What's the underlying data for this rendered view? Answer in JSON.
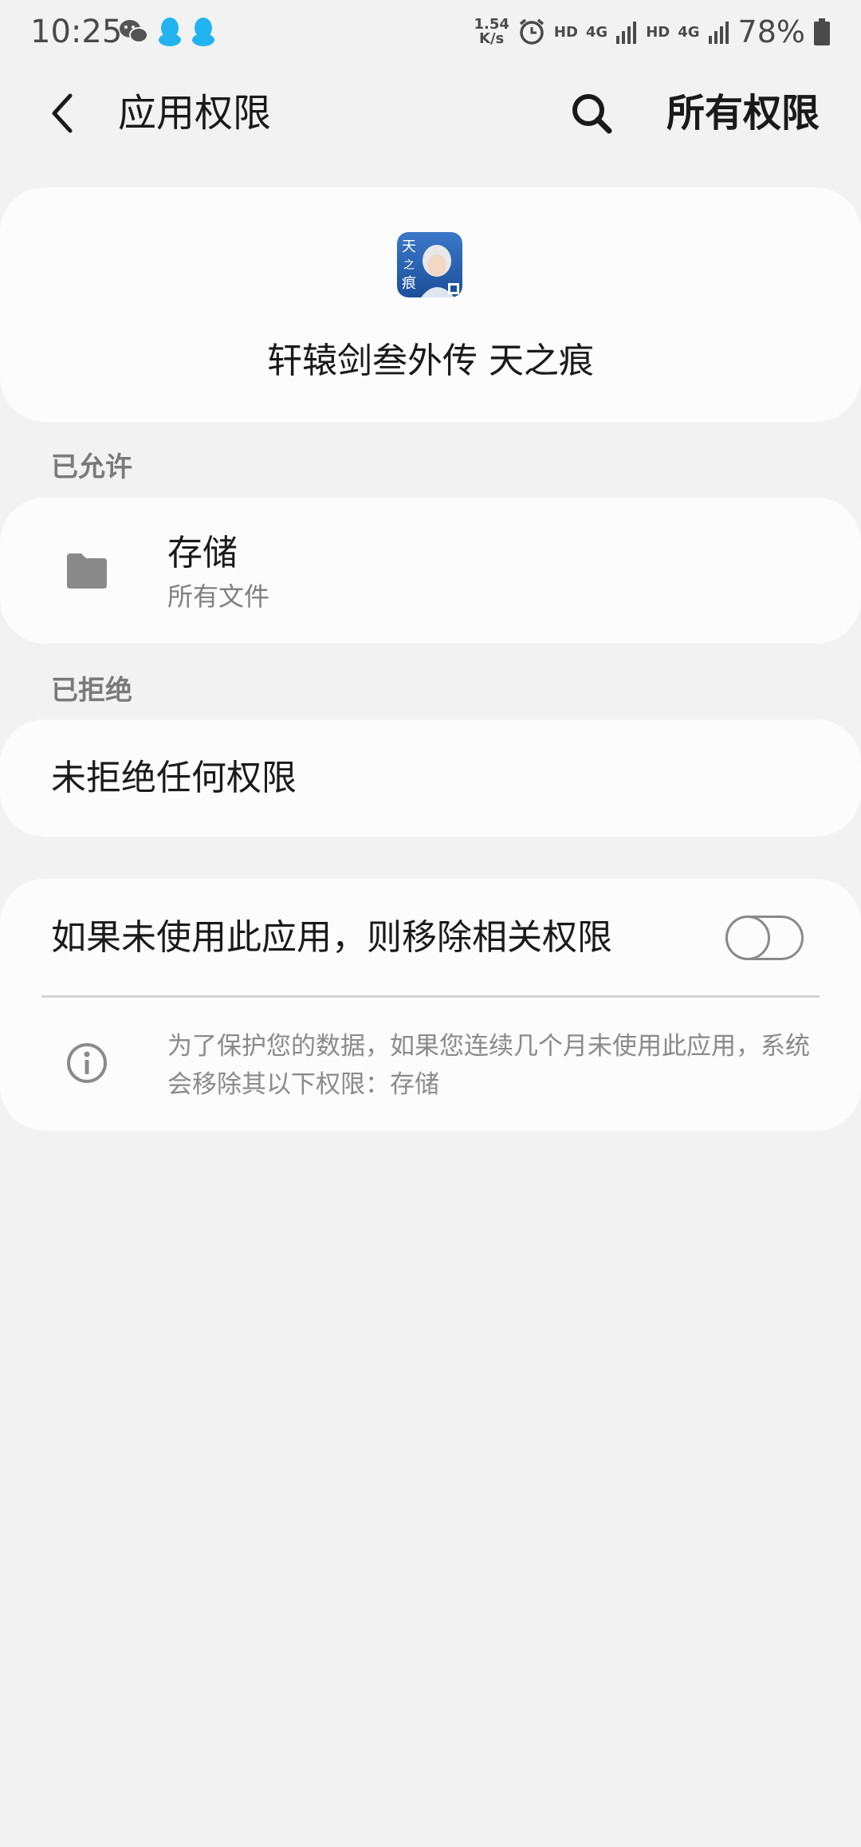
{
  "status_bar": {
    "time": "10:25",
    "notification_icons": [
      "wechat-icon",
      "qq-icon",
      "qq-icon"
    ],
    "network_speed_value": "1.54",
    "network_speed_unit": "K/s",
    "hd1": "HD",
    "net1": "4G",
    "hd2": "HD",
    "net2": "4G",
    "battery_percent": "78%"
  },
  "appbar": {
    "title": "应用权限",
    "all_permissions": "所有权限"
  },
  "app": {
    "name": "轩辕剑叁外传 天之痕",
    "icon_glyph": "天之痕"
  },
  "sections": {
    "allowed_label": "已允许",
    "denied_label": "已拒绝"
  },
  "allowed": {
    "title": "存储",
    "subtitle": "所有文件"
  },
  "denied": {
    "text": "未拒绝任何权限"
  },
  "remove_unused": {
    "label": "如果未使用此应用，则移除相关权限",
    "enabled": false,
    "info_text": "为了保护您的数据，如果您连续几个月未使用此应用，系统会移除其以下权限：存储"
  },
  "colors": {
    "background": "#f2f2f2",
    "card": "#fcfcfc",
    "primary_text": "#1a1a1a",
    "secondary_text": "#808080"
  }
}
